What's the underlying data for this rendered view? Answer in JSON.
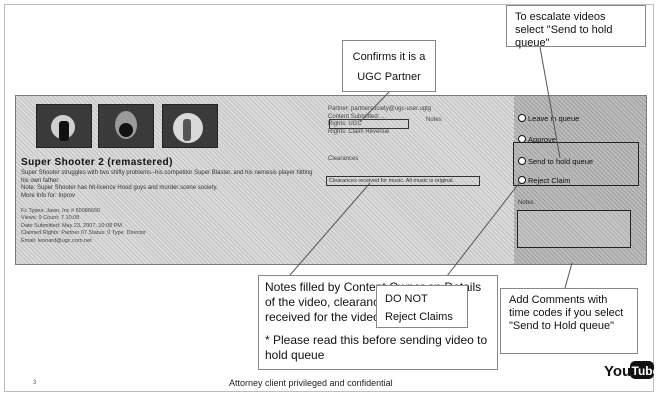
{
  "video": {
    "title": "Super Shooter 2 (remastered)",
    "description": "Super Shooter struggles with two shifty problems--his competitor Super Blaster, and his nemesis player hitting his own father.",
    "description2": "Note: Super Shooter has hit-licence Hood guys and murder scene society.",
    "description3": "More Info for: Inprov",
    "meta_lines": [
      "Fc Types: Jawn, Inc # 60086650",
      "Views: 9 Count: 7 10:08",
      "Date Submitted: May 23, 2007, 10:08 PM",
      "Claimed Rights: Partner 07 Status: 0 Type: Director",
      "Email: leonard@ugc.com.net"
    ]
  },
  "fields": {
    "lines": [
      "Partner: partnersociety@ugc-user.ugtg",
      "Content Submitted: ...",
      "Rights: UGC",
      "Rights: Claim Revenue"
    ],
    "right_tag": "Notes",
    "rights_label": "Clearances",
    "rights_value": "Clearances received for music. All music is original."
  },
  "options": [
    {
      "label": "Leave in queue"
    },
    {
      "label": "Approve"
    },
    {
      "label": "Send to hold queue"
    },
    {
      "label": "Reject Claim"
    }
  ],
  "notes_label": "Notes",
  "callouts": {
    "escalate": "To escalate videos select \"Send to hold queue\"",
    "ugc_line1": "Confirms it is a",
    "ugc_line2": "UGC Partner",
    "notes_main": "Notes filled by Content Owner on Details of the video, clearances they have received for the video.",
    "notes_star": "* Please read this before sending video to hold queue",
    "dont_line1": "DO NOT",
    "dont_line2": "Reject Claims",
    "comments": "Add Comments with time codes if you select \"Send to Hold queue\""
  },
  "footer": "Attorney client privileged and confidential",
  "page_number": "3",
  "logo": {
    "text": "YouTube",
    "part1": "You",
    "part2": "Tube"
  },
  "colors": {
    "panel": "#dcdcdc",
    "panel_right": "#bdbdbd",
    "border": "#888888"
  }
}
